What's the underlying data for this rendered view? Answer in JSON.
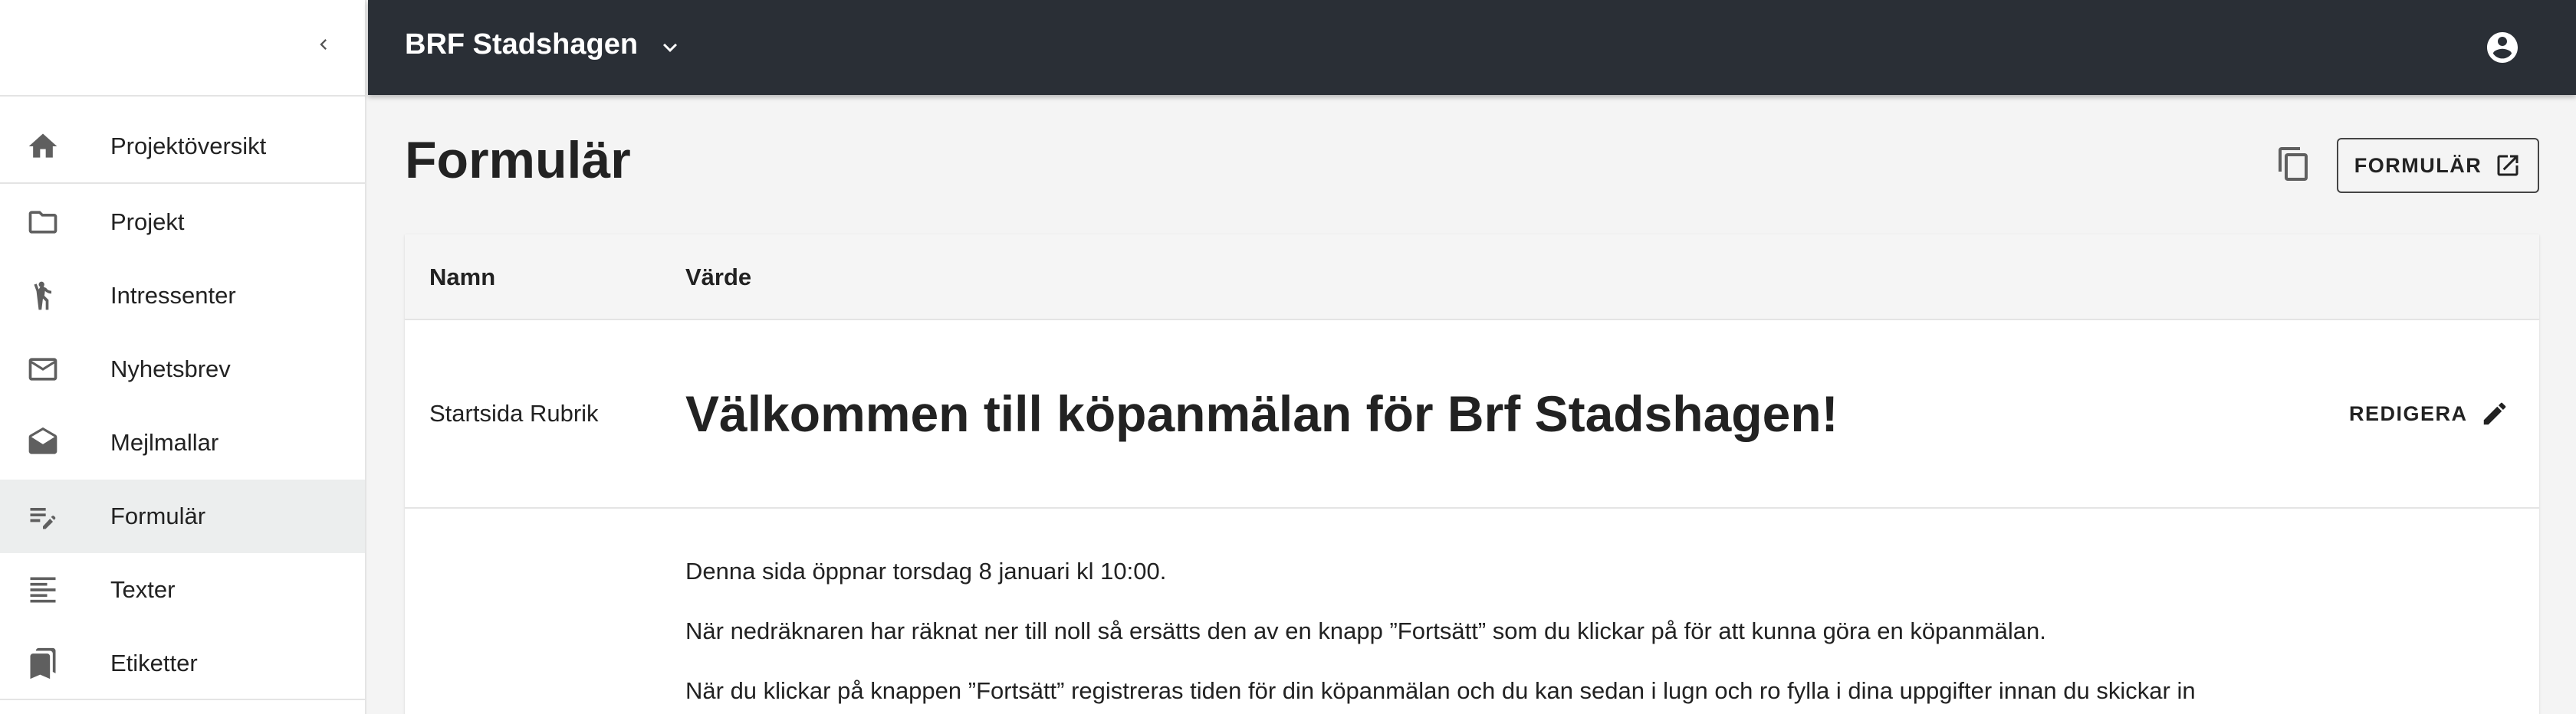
{
  "sidebar": {
    "items": [
      {
        "label": "Projektöversikt",
        "icon": "home-icon"
      },
      {
        "label": "Projekt",
        "icon": "folder-icon"
      },
      {
        "label": "Intressenter",
        "icon": "person-waving-icon"
      },
      {
        "label": "Nyhetsbrev",
        "icon": "mail-icon"
      },
      {
        "label": "Mejlmallar",
        "icon": "drafts-icon"
      },
      {
        "label": "Formulär",
        "icon": "edit-list-icon",
        "active": true
      },
      {
        "label": "Texter",
        "icon": "text-lines-icon"
      },
      {
        "label": "Etiketter",
        "icon": "bookmarks-icon"
      }
    ]
  },
  "topbar": {
    "project_name": "BRF Stadshagen"
  },
  "page": {
    "title": "Formulär",
    "form_button_label": "FORMULÄR"
  },
  "table": {
    "columns": [
      "Namn",
      "Värde"
    ],
    "rows": [
      {
        "name": "Startsida Rubrik",
        "value": "Välkommen till köpanmälan för Brf Stadshagen!",
        "edit_label": "REDIGERA"
      },
      {
        "name": "",
        "paragraphs": [
          "Denna sida öppnar torsdag 8 januari kl 10:00.",
          "När nedräknaren har räknat ner till noll så ersätts den av en knapp ”Fortsätt” som du klickar på för att kunna göra en köpanmälan.",
          "När du klickar på knappen ”Fortsätt” registreras tiden för din köpanmälan och du kan sedan i lugn och ro fylla i dina uppgifter innan du skickar in"
        ]
      }
    ]
  },
  "colors": {
    "topbar_bg": "#2a2f36",
    "page_bg": "#f4f4f4",
    "active_nav_bg": "#eceeee"
  }
}
